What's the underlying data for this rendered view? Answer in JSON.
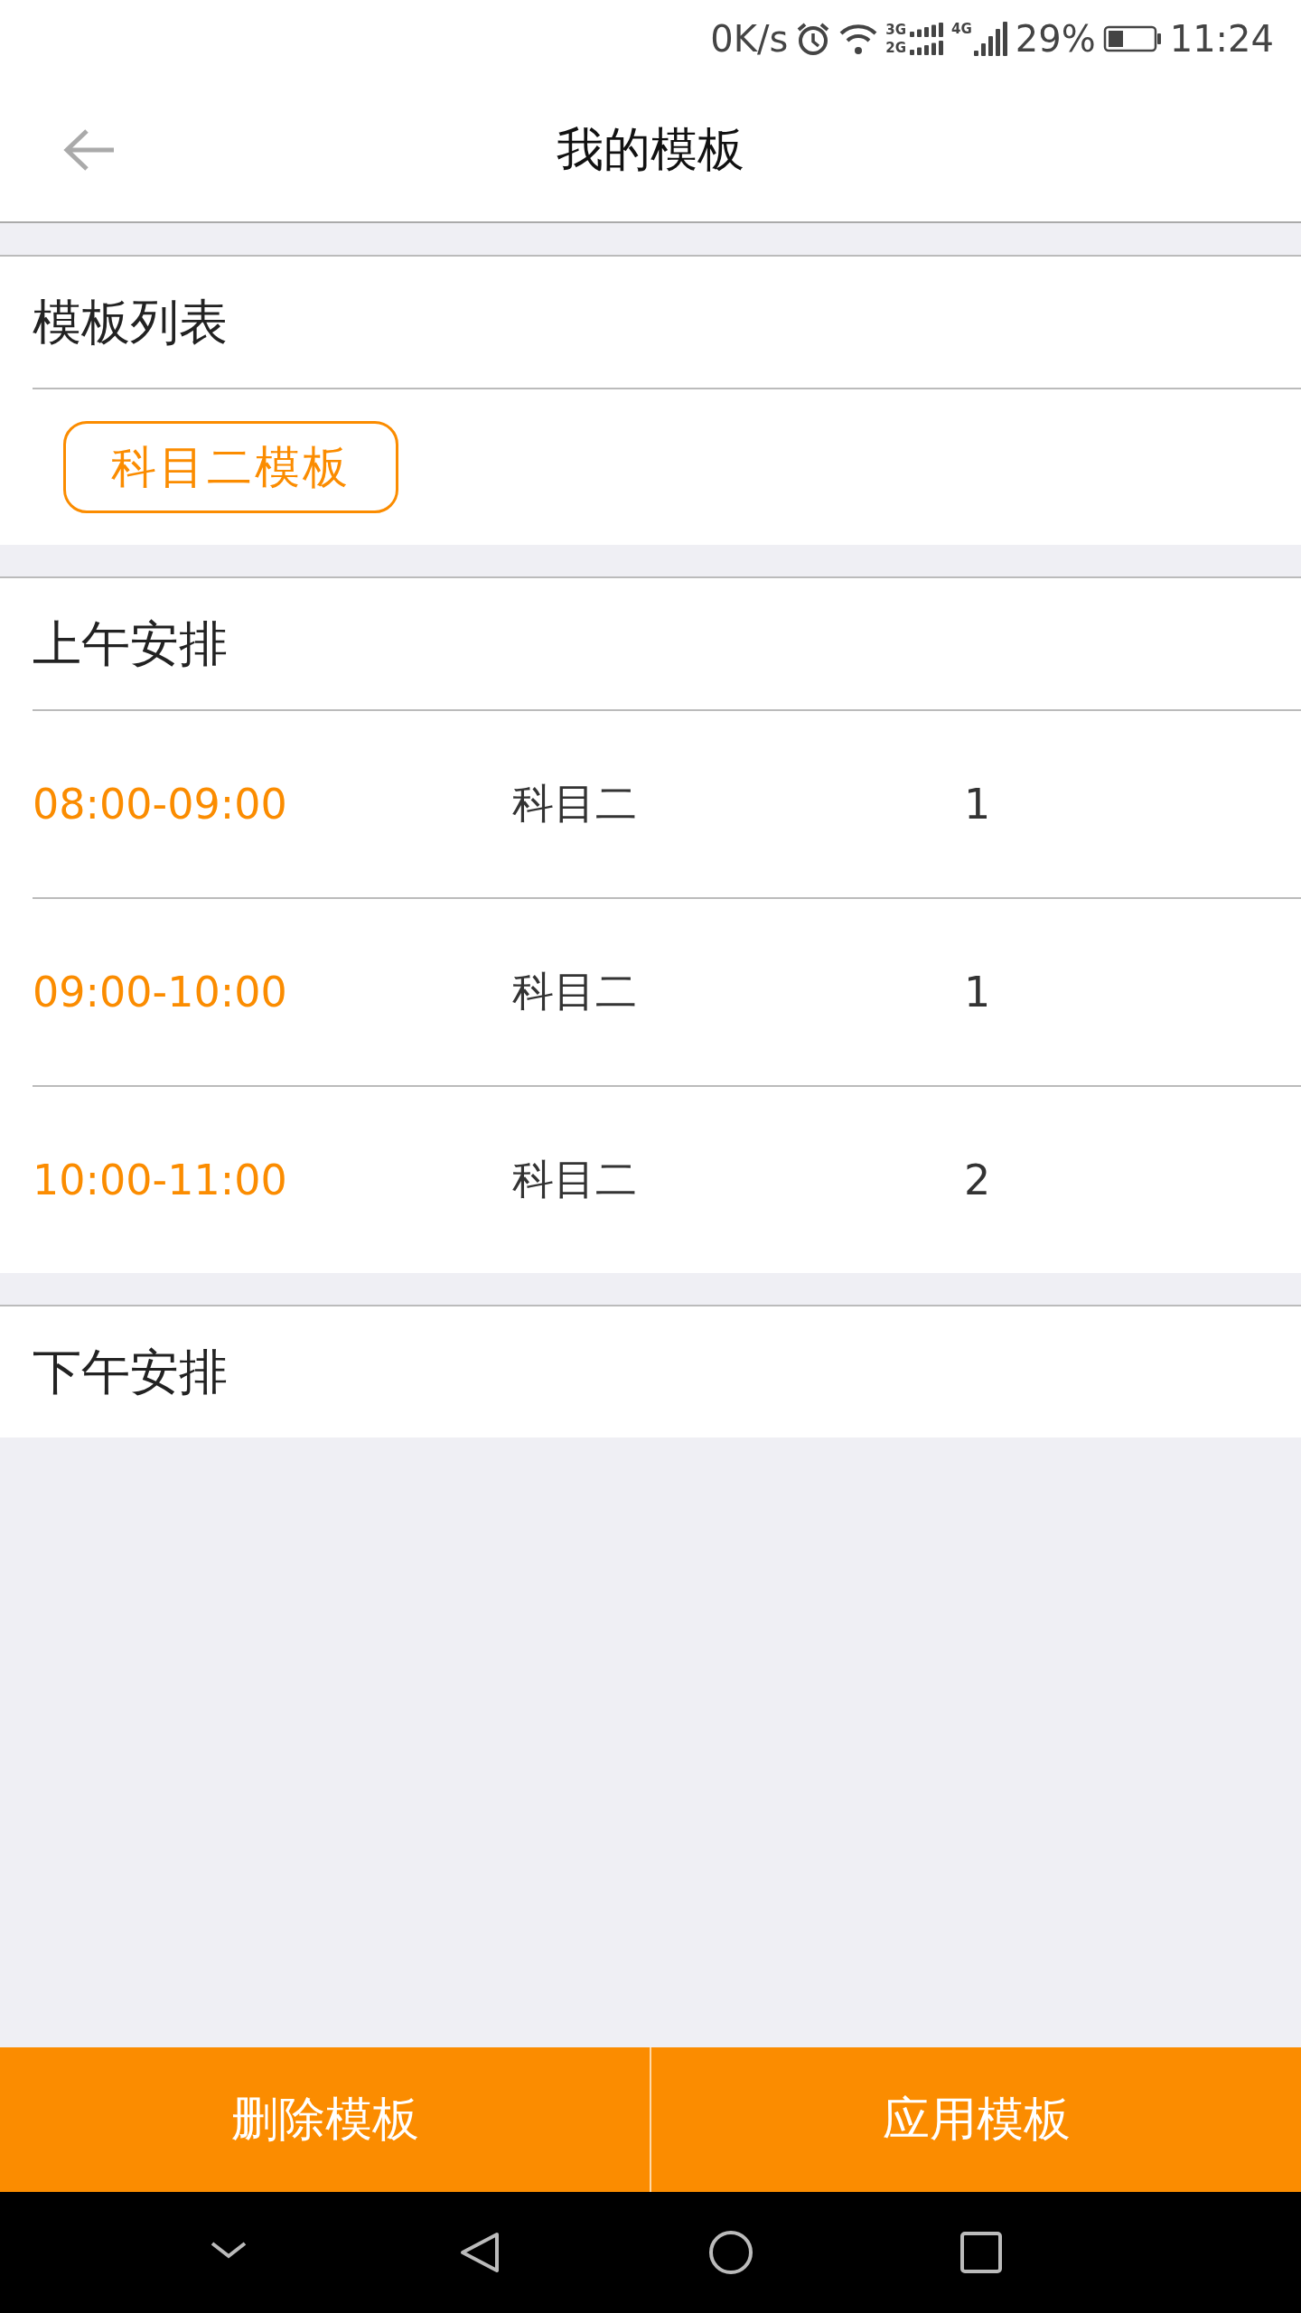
{
  "status_bar": {
    "speed": "0K/s",
    "sim1_labels": [
      "3G",
      "2G"
    ],
    "sim2_label": "4G",
    "battery": "29%",
    "time": "11:24"
  },
  "header": {
    "title": "我的模板"
  },
  "template_list": {
    "title": "模板列表",
    "templates": [
      {
        "label": "科目二模板",
        "selected": true
      }
    ]
  },
  "sections": [
    {
      "title": "上午安排",
      "rows": [
        {
          "time": "08:00-09:00",
          "subject": "科目二",
          "count": "1"
        },
        {
          "time": "09:00-10:00",
          "subject": "科目二",
          "count": "1"
        },
        {
          "time": "10:00-11:00",
          "subject": "科目二",
          "count": "2"
        }
      ]
    },
    {
      "title": "下午安排"
    }
  ],
  "actions": [
    "删除模板",
    "应用模板"
  ]
}
